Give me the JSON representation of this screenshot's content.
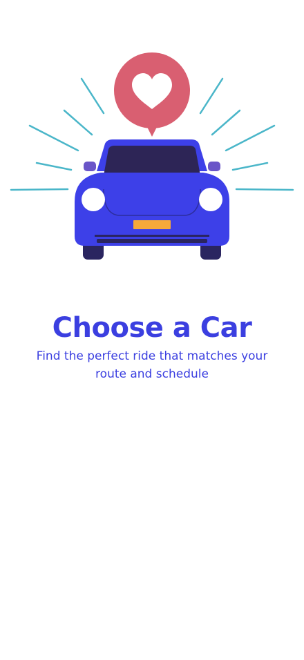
{
  "onboarding": {
    "title": "Choose a Car",
    "subtitle": "Find the perfect ride that matches your route and schedule",
    "illustration": "car-with-heart-bubble-illustration"
  },
  "colors": {
    "accent": "#3b3fe0",
    "car_body": "#3d40e8",
    "heart_bubble": "#d95f71",
    "rays": "#4ab6c9",
    "license_plate": "#f6a93a"
  }
}
